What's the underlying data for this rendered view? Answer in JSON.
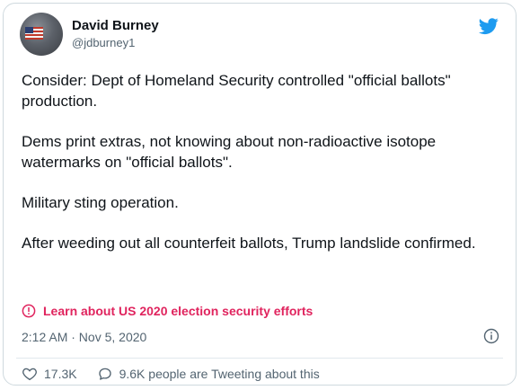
{
  "author": {
    "name": "David Burney",
    "handle": "@jdburney1"
  },
  "tweet": {
    "paragraphs": [
      "Consider: Dept of Homeland Security controlled \"official ballots\" production.",
      "Dems print extras, not knowing about non-radioactive isotope watermarks on \"official ballots\".",
      "Military sting operation.",
      "After weeding out all counterfeit ballots, Trump landslide confirmed."
    ],
    "notice": "Learn about US 2020 election security efforts",
    "timestamp": "2:12 AM · Nov 5, 2020"
  },
  "stats": {
    "likes": "17.3K",
    "conversation": "9.6K people are Tweeting about this"
  },
  "colors": {
    "twitter_blue": "#1d9bf0",
    "notice_red": "#e0245e",
    "muted_text": "#536471"
  },
  "icons": {
    "brand": "twitter-bird-icon",
    "notice": "alert-circle-icon",
    "info": "info-icon",
    "like": "heart-icon",
    "conversation": "speech-bubble-icon"
  }
}
